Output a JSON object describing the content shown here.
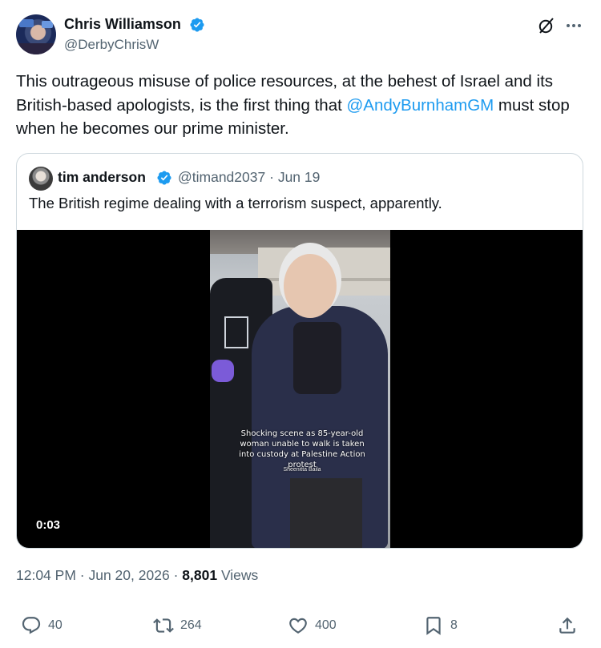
{
  "author": {
    "name": "Chris Williamson",
    "handle": "@DerbyChrisW"
  },
  "tweet": {
    "text_before": "This outrageous misuse of police resources, at the behest of Israel and its British-based apologists, is the first thing that ",
    "mention": "@AndyBurnhamGM",
    "text_after": " must stop when he becomes our prime minister."
  },
  "quote": {
    "name": "tim anderson",
    "handle": "@timand2037",
    "separator": "·",
    "date": "Jun 19",
    "text": "The British regime dealing with a terrorism suspect, apparently.",
    "video": {
      "caption": "Shocking scene as 85-year-old woman unable to walk is taken into custody at Palestine Action protest",
      "credit": "Sheenitta Baila",
      "duration": "0:03"
    }
  },
  "meta": {
    "time": "12:04 PM",
    "sep1": "·",
    "date": "Jun 20, 2026",
    "sep2": "·",
    "views_count": "8,801",
    "views_label": "Views"
  },
  "actions": {
    "replies": "40",
    "reposts": "264",
    "likes": "400",
    "bookmarks": "8"
  },
  "icons": {
    "verified": "verified-badge-icon",
    "grok": "grok-icon",
    "more": "more-icon",
    "reply": "reply-icon",
    "repost": "repost-icon",
    "like": "heart-icon",
    "bookmark": "bookmark-icon",
    "share": "share-icon"
  },
  "colors": {
    "accent": "#1d9bf0",
    "text_primary": "#0f1419",
    "text_secondary": "#536471",
    "border": "#cfd9de"
  }
}
